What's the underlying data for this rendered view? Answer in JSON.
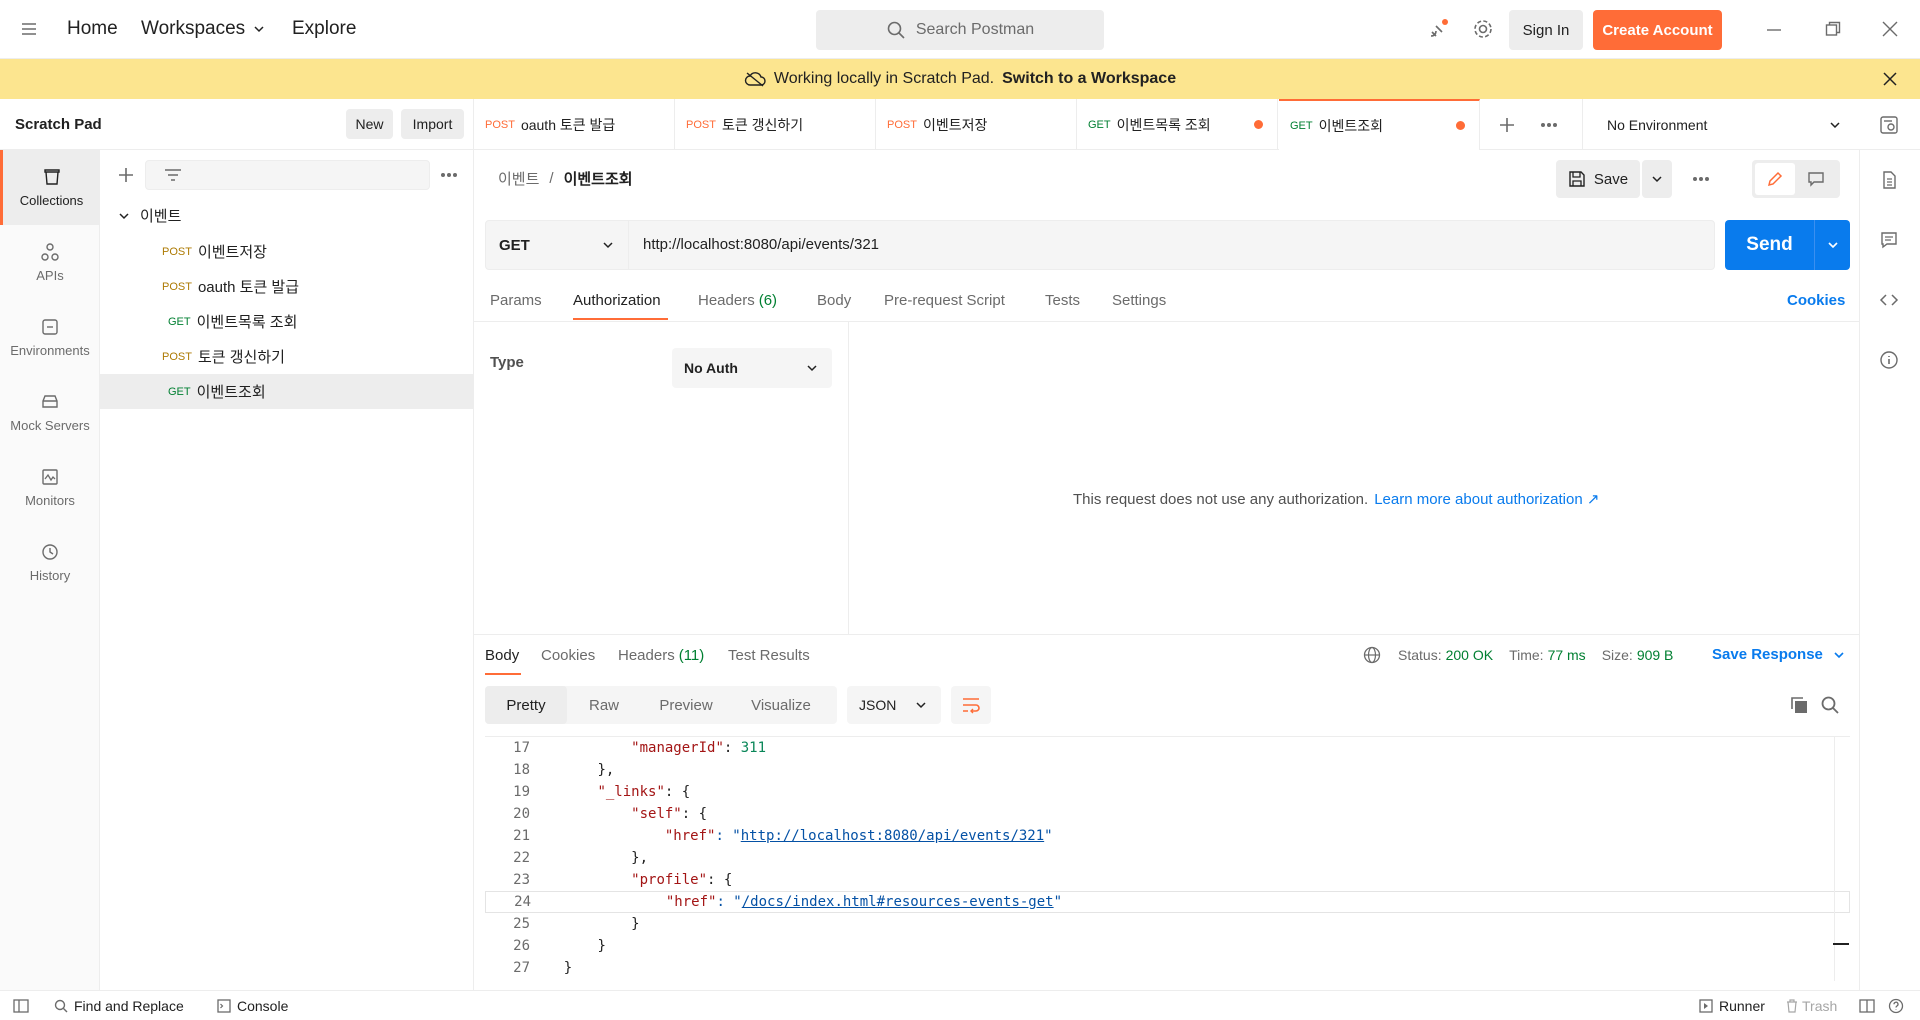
{
  "topbar": {
    "home": "Home",
    "workspaces": "Workspaces",
    "explore": "Explore",
    "search_placeholder": "Search Postman",
    "sign_in": "Sign In",
    "create_account": "Create Account"
  },
  "banner": {
    "text": "Working locally in Scratch Pad.",
    "link": "Switch to a Workspace"
  },
  "sidebar_header": {
    "title": "Scratch Pad",
    "new": "New",
    "import": "Import"
  },
  "rail": {
    "items": [
      {
        "label": "Collections"
      },
      {
        "label": "APIs"
      },
      {
        "label": "Environments"
      },
      {
        "label": "Mock Servers"
      },
      {
        "label": "Monitors"
      },
      {
        "label": "History"
      }
    ]
  },
  "collection": {
    "name": "이벤트",
    "requests": [
      {
        "method": "POST",
        "name": "이벤트저장"
      },
      {
        "method": "POST",
        "name": "oauth 토큰 발급"
      },
      {
        "method": "GET",
        "name": "이벤트목록 조회"
      },
      {
        "method": "POST",
        "name": "토큰 갱신하기"
      },
      {
        "method": "GET",
        "name": "이벤트조회"
      }
    ]
  },
  "tabs": [
    {
      "method": "POST",
      "name": "oauth 토큰 발급"
    },
    {
      "method": "POST",
      "name": "토큰 갱신하기"
    },
    {
      "method": "POST",
      "name": "이벤트저장"
    },
    {
      "method": "GET",
      "name": "이벤트목록 조회"
    },
    {
      "method": "GET",
      "name": "이벤트조회"
    }
  ],
  "environment": "No Environment",
  "breadcrumb": {
    "parent": "이벤트",
    "sep": "/",
    "current": "이벤트조회"
  },
  "save": "Save",
  "request": {
    "method": "GET",
    "url": "http://localhost:8080/api/events/321",
    "send": "Send"
  },
  "req_tabs": {
    "params": "Params",
    "authorization": "Authorization",
    "headers": "Headers",
    "headers_count": "(6)",
    "body": "Body",
    "prerequest": "Pre-request Script",
    "tests": "Tests",
    "settings": "Settings",
    "cookies": "Cookies"
  },
  "auth": {
    "type_label": "Type",
    "type_value": "No Auth",
    "message": "This request does not use any authorization.",
    "learn_more": "Learn more about authorization ↗"
  },
  "response": {
    "tabs": {
      "body": "Body",
      "cookies": "Cookies",
      "headers": "Headers",
      "headers_count": "(11)",
      "test_results": "Test Results"
    },
    "status_label": "Status:",
    "status_value": "200 OK",
    "time_label": "Time:",
    "time_value": "77 ms",
    "size_label": "Size:",
    "size_value": "909 B",
    "save_response": "Save Response",
    "views": {
      "pretty": "Pretty",
      "raw": "Raw",
      "preview": "Preview",
      "visualize": "Visualize"
    },
    "format": "JSON"
  },
  "code": {
    "lines": [
      {
        "n": "17",
        "indent": "            ",
        "key": "\"managerId\"",
        "rest": ": ",
        "val": "311",
        "valType": "num"
      },
      {
        "n": "18",
        "indent": "        ",
        "key": "",
        "rest": "},",
        "val": "",
        "valType": ""
      },
      {
        "n": "19",
        "indent": "        ",
        "key": "\"_links\"",
        "rest": ": {",
        "val": "",
        "valType": ""
      },
      {
        "n": "20",
        "indent": "            ",
        "key": "\"self\"",
        "rest": ": {",
        "val": "",
        "valType": ""
      },
      {
        "n": "21",
        "indent": "                ",
        "key": "\"href\"",
        "rest": ": \"",
        "val": "http://localhost:8080/api/events/321",
        "valType": "link"
      },
      {
        "n": "22",
        "indent": "            ",
        "key": "",
        "rest": "},",
        "val": "",
        "valType": ""
      },
      {
        "n": "23",
        "indent": "            ",
        "key": "\"profile\"",
        "rest": ": {",
        "val": "",
        "valType": ""
      },
      {
        "n": "24",
        "indent": "                ",
        "key": "\"href\"",
        "rest": ": \"",
        "val": "/docs/index.html#resources-events-get",
        "valType": "link"
      },
      {
        "n": "25",
        "indent": "            ",
        "key": "",
        "rest": "}",
        "val": "",
        "valType": ""
      },
      {
        "n": "26",
        "indent": "        ",
        "key": "",
        "rest": "}",
        "val": "",
        "valType": ""
      },
      {
        "n": "27",
        "indent": "    ",
        "key": "",
        "rest": "}",
        "val": "",
        "valType": ""
      }
    ]
  },
  "statusbar": {
    "find_replace": "Find and Replace",
    "console": "Console",
    "runner": "Runner",
    "trash": "Trash"
  },
  "colors": {
    "accent": "#ff6c37",
    "primary": "#097bed",
    "banner": "#fce58f",
    "post": "#ad7a03",
    "get": "#007f31"
  }
}
